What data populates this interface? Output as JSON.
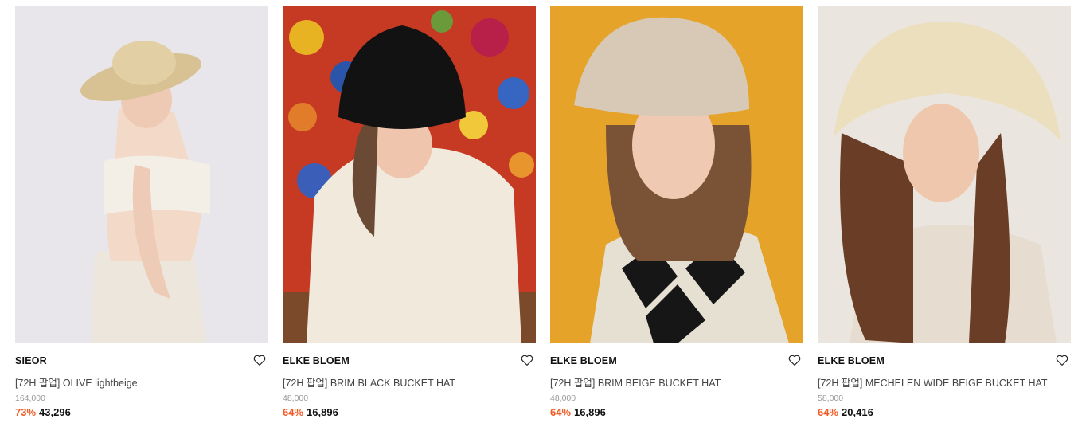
{
  "products": [
    {
      "brand": "SIEOR",
      "name": "[72H 팝업] OLIVE lightbeige",
      "original_price": "164,000",
      "discount": "73%",
      "price": "43,296",
      "bg": "#e7e5ea",
      "hat": "#dcc79c"
    },
    {
      "brand": "ELKE BLOEM",
      "name": "[72H 팝업] BRIM BLACK BUCKET HAT",
      "original_price": "48,000",
      "discount": "64%",
      "price": "16,896",
      "bg": "#c43a25",
      "hat": "#121212"
    },
    {
      "brand": "ELKE BLOEM",
      "name": "[72H 팝업] BRIM BEIGE BUCKET HAT",
      "original_price": "48,000",
      "discount": "64%",
      "price": "16,896",
      "bg": "#e7a42a",
      "hat": "#d9cab8"
    },
    {
      "brand": "ELKE BLOEM",
      "name": "[72H 팝업] MECHELEN WIDE BEIGE BUCKET HAT",
      "original_price": "58,000",
      "discount": "64%",
      "price": "20,416",
      "bg": "#eae4de",
      "hat": "#ecdfbd"
    }
  ],
  "icons": {
    "wishlist": "heart-outline-icon"
  },
  "colors": {
    "discount": "#f05a24",
    "brand_text": "#111111",
    "orig_price": "#999999"
  }
}
